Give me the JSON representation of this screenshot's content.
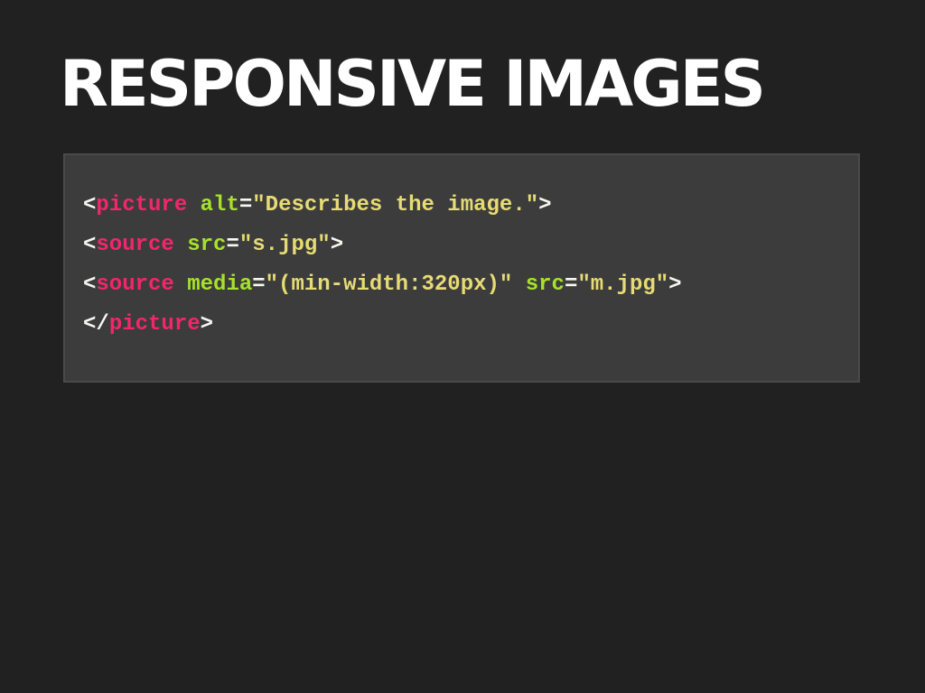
{
  "slide": {
    "title": "RESPONSIVE IMAGES"
  },
  "code": {
    "line1": {
      "open": "<",
      "tag": "picture",
      "space1": " ",
      "attr1": "alt",
      "eq1": "=",
      "val1": "\"Describes the image.\"",
      "close": ">"
    },
    "line2": {
      "open": "<",
      "tag": "source",
      "space1": " ",
      "attr1": "src",
      "eq1": "=",
      "val1": "\"s.jpg\"",
      "close": ">"
    },
    "line3": {
      "open": "<",
      "tag": "source",
      "space1": " ",
      "attr1": "media",
      "eq1": "=",
      "val1": "\"(min-width:320px)\"",
      "space2": " ",
      "attr2": "src",
      "eq2": "=",
      "val2": "\"m.jpg\"",
      "close": ">"
    },
    "line4": {
      "open": "</",
      "tag": "picture",
      "close": ">"
    }
  },
  "colors": {
    "background": "#212121",
    "code_background": "#3c3c3c",
    "tag": "#f2266c",
    "attribute": "#a6e22b",
    "string": "#e6db74",
    "punctuation": "#f8f8f2"
  }
}
